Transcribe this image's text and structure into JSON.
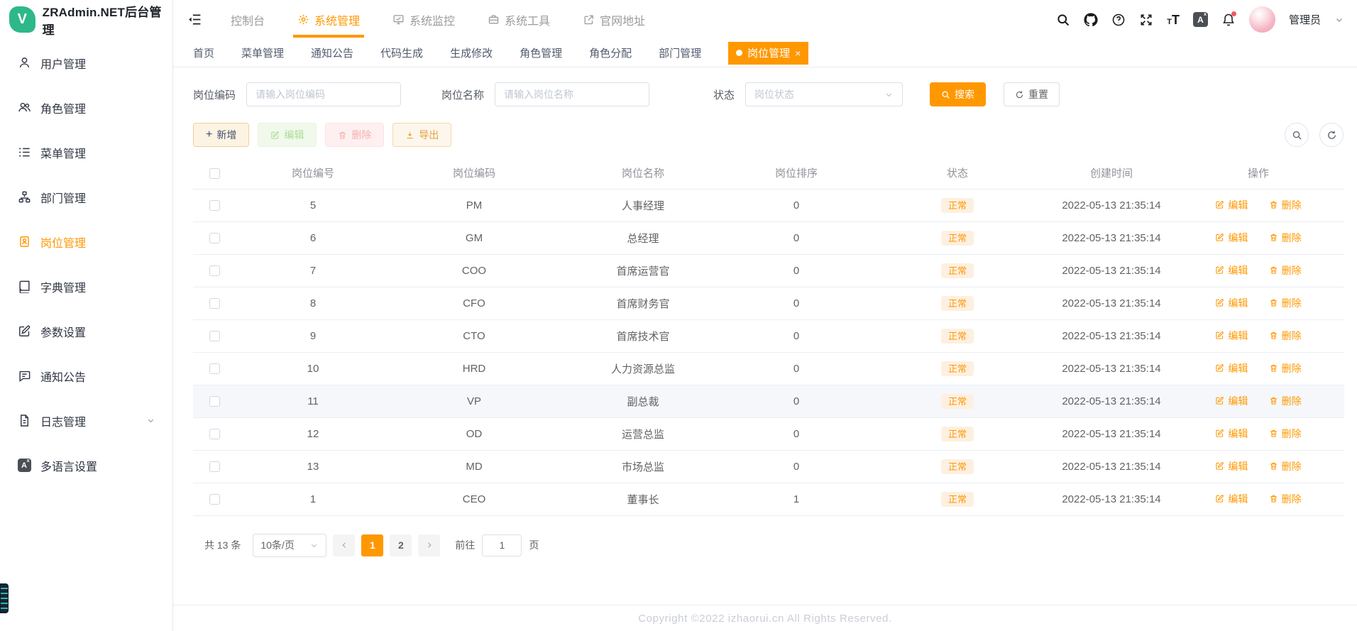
{
  "colors": {
    "accent": "#ff9800"
  },
  "app": {
    "title": "ZRAdmin.NET后台管理",
    "logo_letter": "V"
  },
  "topnav": {
    "items": [
      {
        "label": "控制台",
        "active": false
      },
      {
        "label": "系统管理",
        "active": true
      },
      {
        "label": "系统监控",
        "active": false
      },
      {
        "label": "系统工具",
        "active": false
      },
      {
        "label": "官网地址",
        "active": false
      }
    ],
    "user_name": "管理员"
  },
  "sidebar": {
    "items": [
      {
        "label": "用户管理",
        "active": false
      },
      {
        "label": "角色管理",
        "active": false
      },
      {
        "label": "菜单管理",
        "active": false
      },
      {
        "label": "部门管理",
        "active": false
      },
      {
        "label": "岗位管理",
        "active": true
      },
      {
        "label": "字典管理",
        "active": false
      },
      {
        "label": "参数设置",
        "active": false
      },
      {
        "label": "通知公告",
        "active": false
      },
      {
        "label": "日志管理",
        "active": false,
        "expandable": true
      },
      {
        "label": "多语言设置",
        "active": false
      }
    ]
  },
  "tabs": {
    "items": [
      {
        "label": "首页",
        "active": false
      },
      {
        "label": "菜单管理",
        "active": false
      },
      {
        "label": "通知公告",
        "active": false
      },
      {
        "label": "代码生成",
        "active": false
      },
      {
        "label": "生成修改",
        "active": false
      },
      {
        "label": "角色管理",
        "active": false
      },
      {
        "label": "角色分配",
        "active": false
      },
      {
        "label": "部门管理",
        "active": false
      },
      {
        "label": "岗位管理",
        "active": true
      }
    ]
  },
  "filters": {
    "code_label": "岗位编码",
    "code_placeholder": "请输入岗位编码",
    "name_label": "岗位名称",
    "name_placeholder": "请输入岗位名称",
    "status_label": "状态",
    "status_placeholder": "岗位状态",
    "search_label": "搜索",
    "reset_label": "重置"
  },
  "toolbar": {
    "add_label": "新增",
    "edit_label": "编辑",
    "delete_label": "删除",
    "export_label": "导出"
  },
  "table": {
    "columns": {
      "id": "岗位编号",
      "code": "岗位编码",
      "name": "岗位名称",
      "sort": "岗位排序",
      "status": "状态",
      "created": "创建时间",
      "actions": "操作"
    },
    "row_edit_label": "编辑",
    "row_delete_label": "删除",
    "rows": [
      {
        "id": "5",
        "code": "PM",
        "name": "人事经理",
        "sort": "0",
        "status": "正常",
        "created": "2022-05-13 21:35:14",
        "highlight": false
      },
      {
        "id": "6",
        "code": "GM",
        "name": "总经理",
        "sort": "0",
        "status": "正常",
        "created": "2022-05-13 21:35:14",
        "highlight": false
      },
      {
        "id": "7",
        "code": "COO",
        "name": "首席运营官",
        "sort": "0",
        "status": "正常",
        "created": "2022-05-13 21:35:14",
        "highlight": false
      },
      {
        "id": "8",
        "code": "CFO",
        "name": "首席财务官",
        "sort": "0",
        "status": "正常",
        "created": "2022-05-13 21:35:14",
        "highlight": false
      },
      {
        "id": "9",
        "code": "CTO",
        "name": "首席技术官",
        "sort": "0",
        "status": "正常",
        "created": "2022-05-13 21:35:14",
        "highlight": false
      },
      {
        "id": "10",
        "code": "HRD",
        "name": "人力资源总监",
        "sort": "0",
        "status": "正常",
        "created": "2022-05-13 21:35:14",
        "highlight": false
      },
      {
        "id": "11",
        "code": "VP",
        "name": "副总裁",
        "sort": "0",
        "status": "正常",
        "created": "2022-05-13 21:35:14",
        "highlight": true
      },
      {
        "id": "12",
        "code": "OD",
        "name": "运营总监",
        "sort": "0",
        "status": "正常",
        "created": "2022-05-13 21:35:14",
        "highlight": false
      },
      {
        "id": "13",
        "code": "MD",
        "name": "市场总监",
        "sort": "0",
        "status": "正常",
        "created": "2022-05-13 21:35:14",
        "highlight": false
      },
      {
        "id": "1",
        "code": "CEO",
        "name": "董事长",
        "sort": "1",
        "status": "正常",
        "created": "2022-05-13 21:35:14",
        "highlight": false
      }
    ]
  },
  "pagination": {
    "total_text": "共 13 条",
    "page_size": "10条/页",
    "pages": [
      {
        "label": "1",
        "active": true
      },
      {
        "label": "2",
        "active": false
      }
    ],
    "goto_label": "前往",
    "goto_value": "1",
    "page_unit": "页"
  },
  "footer": {
    "copyright": "Copyright ©2022 izhaorui.cn All Rights Reserved."
  }
}
